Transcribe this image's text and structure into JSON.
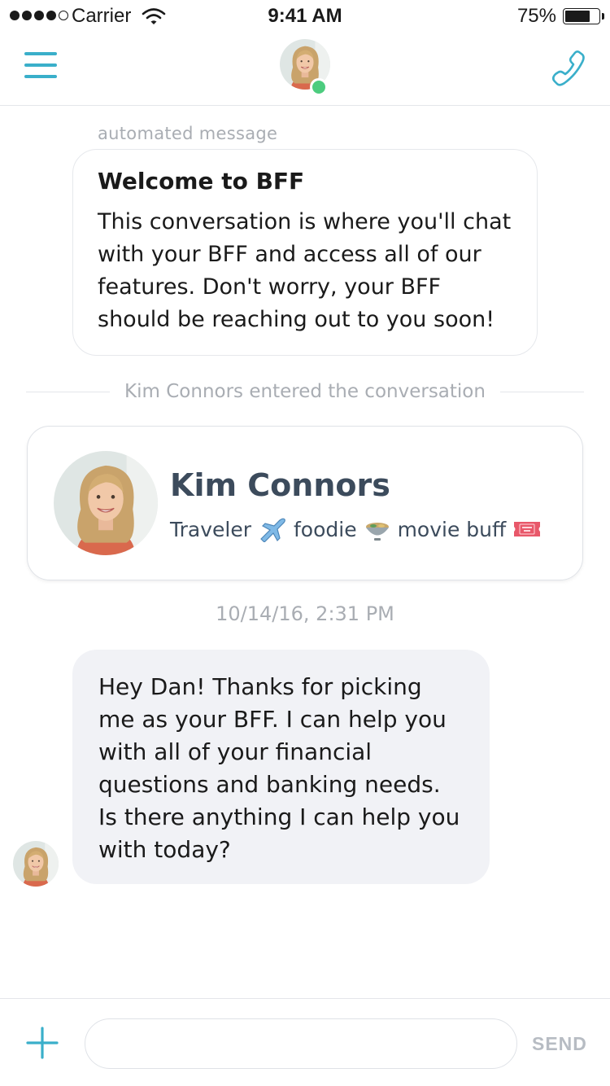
{
  "status_bar": {
    "carrier": "Carrier",
    "time": "9:41 AM",
    "battery_percent": "75%",
    "battery_level": 0.75,
    "signal_bars_filled": 4,
    "signal_bars_total": 5
  },
  "nav": {
    "menu_icon": "hamburger-menu-icon",
    "call_icon": "phone-icon",
    "online_status_color": "#4ccc7e",
    "accent_color": "#3aafca"
  },
  "chat": {
    "automated_label": "automated message",
    "welcome_title": "Welcome to BFF",
    "welcome_body": "This conversation is where you'll chat with your BFF and access all of our features. Don't worry, your BFF should be reaching out to you soon!",
    "system_event": "Kim Connors entered the conversation",
    "profile": {
      "name": "Kim Connors",
      "tag1": "Traveler",
      "tag2": "foodie",
      "tag3": "movie buff",
      "tag1_icon": "airplane-icon",
      "tag2_icon": "food-bowl-icon",
      "tag3_icon": "admit-one-ticket-icon"
    },
    "timestamp": "10/14/16, 2:31 PM",
    "incoming_message": "Hey Dan! Thanks for picking me as your BFF. I can help you with all of your financial questions and banking needs. Is there anything I can help you with today?"
  },
  "composer": {
    "add_icon": "plus-icon",
    "input_value": "",
    "input_placeholder": "",
    "send_label": "SEND"
  }
}
